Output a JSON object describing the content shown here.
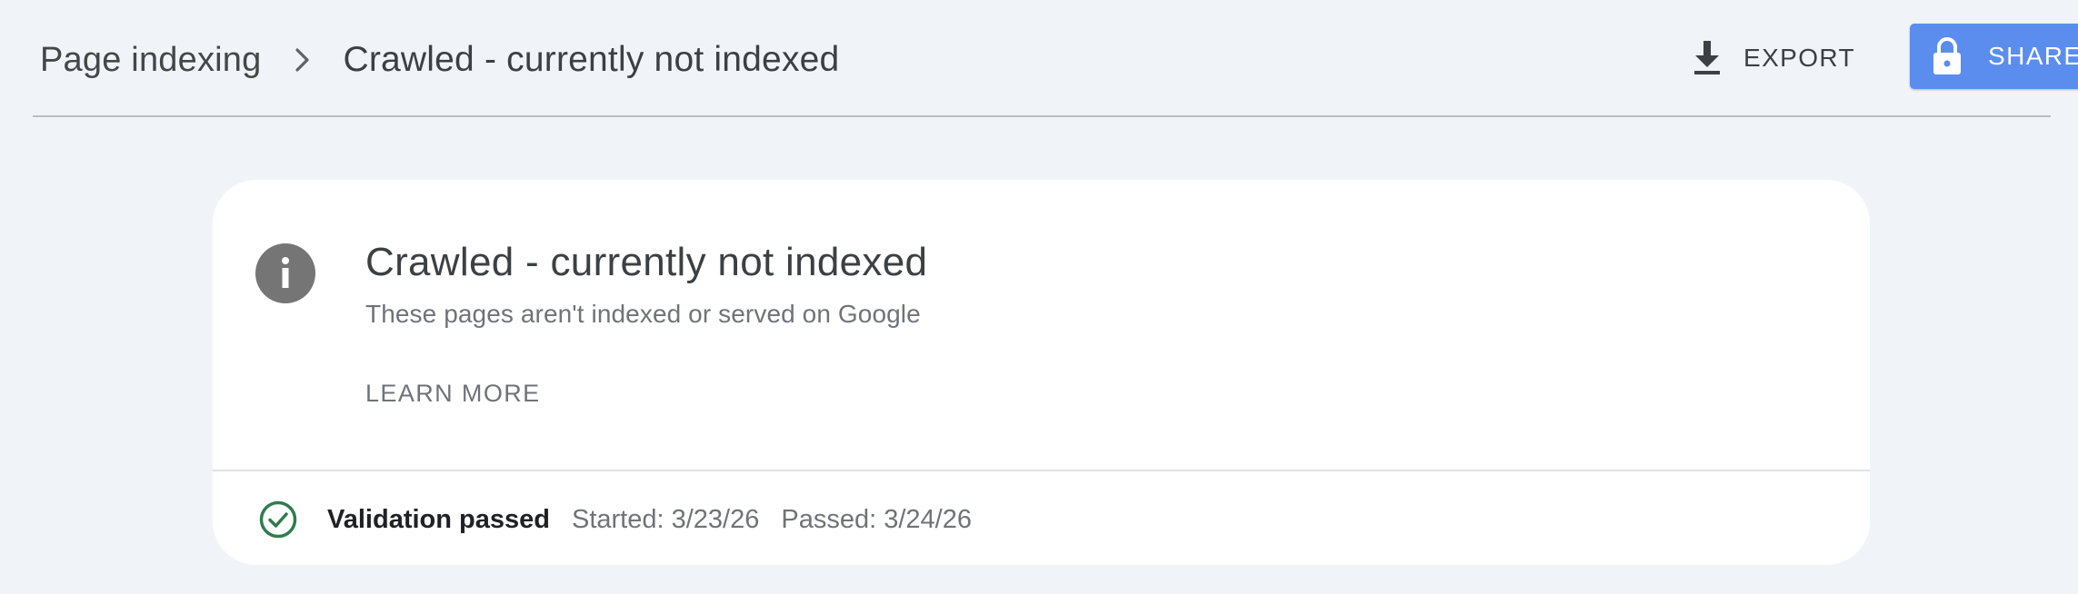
{
  "header": {
    "breadcrumb_parent": "Page indexing",
    "breadcrumb_current": "Crawled - currently not indexed",
    "export_label": "EXPORT",
    "share_label": "SHARE"
  },
  "icons": {
    "breadcrumb_separator": "chevron-right-icon",
    "export": "download-icon",
    "share": "lock-icon",
    "info": "info-icon",
    "status": "check-circle-icon"
  },
  "card": {
    "title": "Crawled - currently not indexed",
    "subtitle": "These pages aren't indexed or served on Google",
    "learn_more": "LEARN MORE",
    "validation": {
      "status": "Validation passed",
      "started": "Started: 3/23/26",
      "passed": "Passed: 3/24/26"
    }
  },
  "colors": {
    "page_background": "#f0f4f9",
    "share_button": "#5b8def",
    "info_icon": "#757575",
    "success": "#2e7d4f"
  }
}
